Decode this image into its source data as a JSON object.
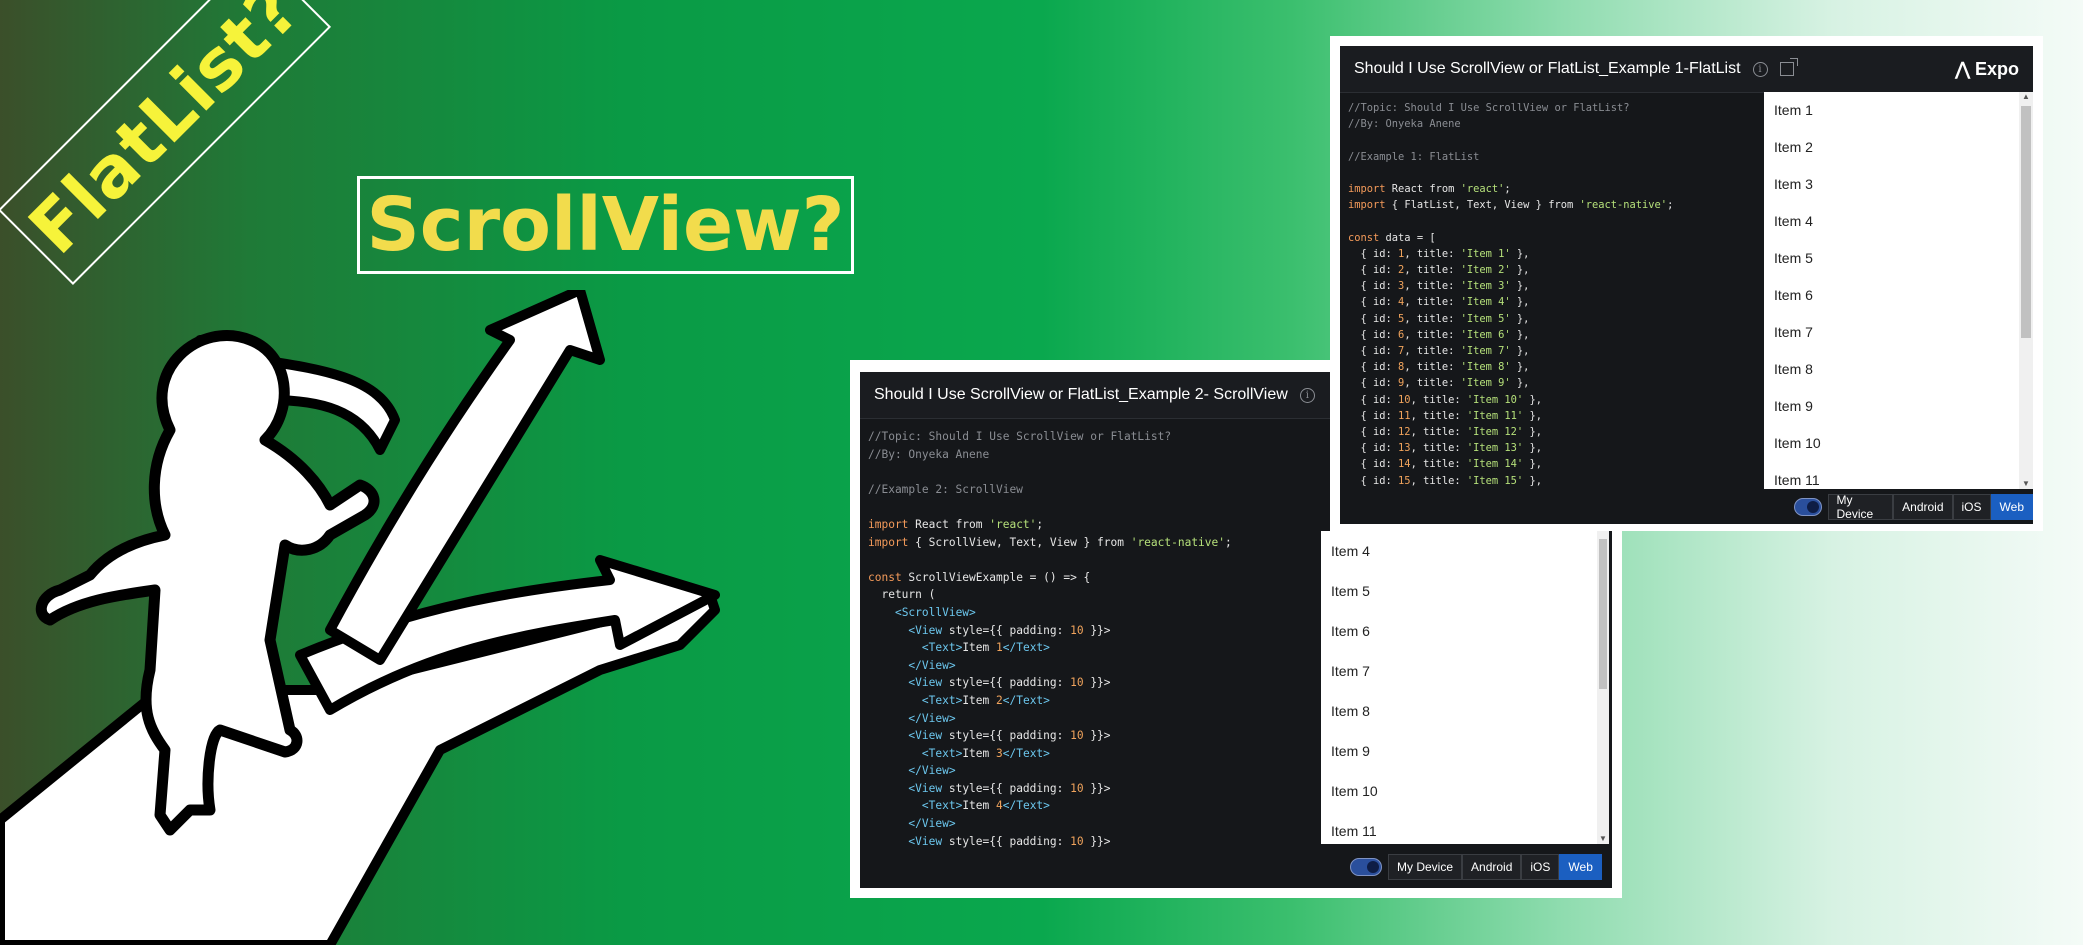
{
  "colors": {
    "flatlist_text": "#f6f33a",
    "scrollview_text": "#f2dc4c",
    "active_tab": "#1b5fc1"
  },
  "titles": {
    "flatlist": "FlatList?",
    "scrollview": "ScrollView?"
  },
  "panel_flatlist": {
    "title": "Should I Use ScrollView or FlatList_Example 1-FlatList",
    "logo": "Expo",
    "code_lines": [
      "//Topic: Should I Use ScrollView or FlatList?",
      "//By: Onyeka Anene",
      "",
      "//Example 1: FlatList",
      "",
      "import React from 'react';",
      "import { FlatList, Text, View } from 'react-native';",
      "",
      "const data = [",
      "  { id: 1, title: 'Item 1' },",
      "  { id: 2, title: 'Item 2' },",
      "  { id: 3, title: 'Item 3' },",
      "  { id: 4, title: 'Item 4' },",
      "  { id: 5, title: 'Item 5' },",
      "  { id: 6, title: 'Item 6' },",
      "  { id: 7, title: 'Item 7' },",
      "  { id: 8, title: 'Item 8' },",
      "  { id: 9, title: 'Item 9' },",
      "  { id: 10, title: 'Item 10' },",
      "  { id: 11, title: 'Item 11' },",
      "  { id: 12, title: 'Item 12' },",
      "  { id: 13, title: 'Item 13' },",
      "  { id: 14, title: 'Item 14' },",
      "  { id: 15, title: 'Item 15' },"
    ],
    "items": [
      "Item 1",
      "Item 2",
      "Item 3",
      "Item 4",
      "Item 5",
      "Item 6",
      "Item 7",
      "Item 8",
      "Item 9",
      "Item 10",
      "Item 11"
    ],
    "buttons": [
      "My Device",
      "Android",
      "iOS",
      "Web"
    ],
    "active_button": "Web"
  },
  "panel_scrollview": {
    "title": "Should I Use ScrollView or FlatList_Example 2- ScrollView",
    "code_lines": [
      "//Topic: Should I Use ScrollView or FlatList?",
      "//By: Onyeka Anene",
      "",
      "//Example 2: ScrollView",
      "",
      "import React from 'react';",
      "import { ScrollView, Text, View } from 'react-native';",
      "",
      "const ScrollViewExample = () => {",
      "  return (",
      "    <ScrollView>",
      "      <View style={{ padding: 10 }}>",
      "        <Text>Item 1</Text>",
      "      </View>",
      "      <View style={{ padding: 10 }}>",
      "        <Text>Item 2</Text>",
      "      </View>",
      "      <View style={{ padding: 10 }}>",
      "        <Text>Item 3</Text>",
      "      </View>",
      "      <View style={{ padding: 10 }}>",
      "        <Text>Item 4</Text>",
      "      </View>",
      "      <View style={{ padding: 10 }}>"
    ],
    "items": [
      "Item 4",
      "Item 5",
      "Item 6",
      "Item 7",
      "Item 8",
      "Item 9",
      "Item 10",
      "Item 11"
    ],
    "buttons": [
      "My Device",
      "Android",
      "iOS",
      "Web"
    ],
    "active_button": "Web"
  }
}
